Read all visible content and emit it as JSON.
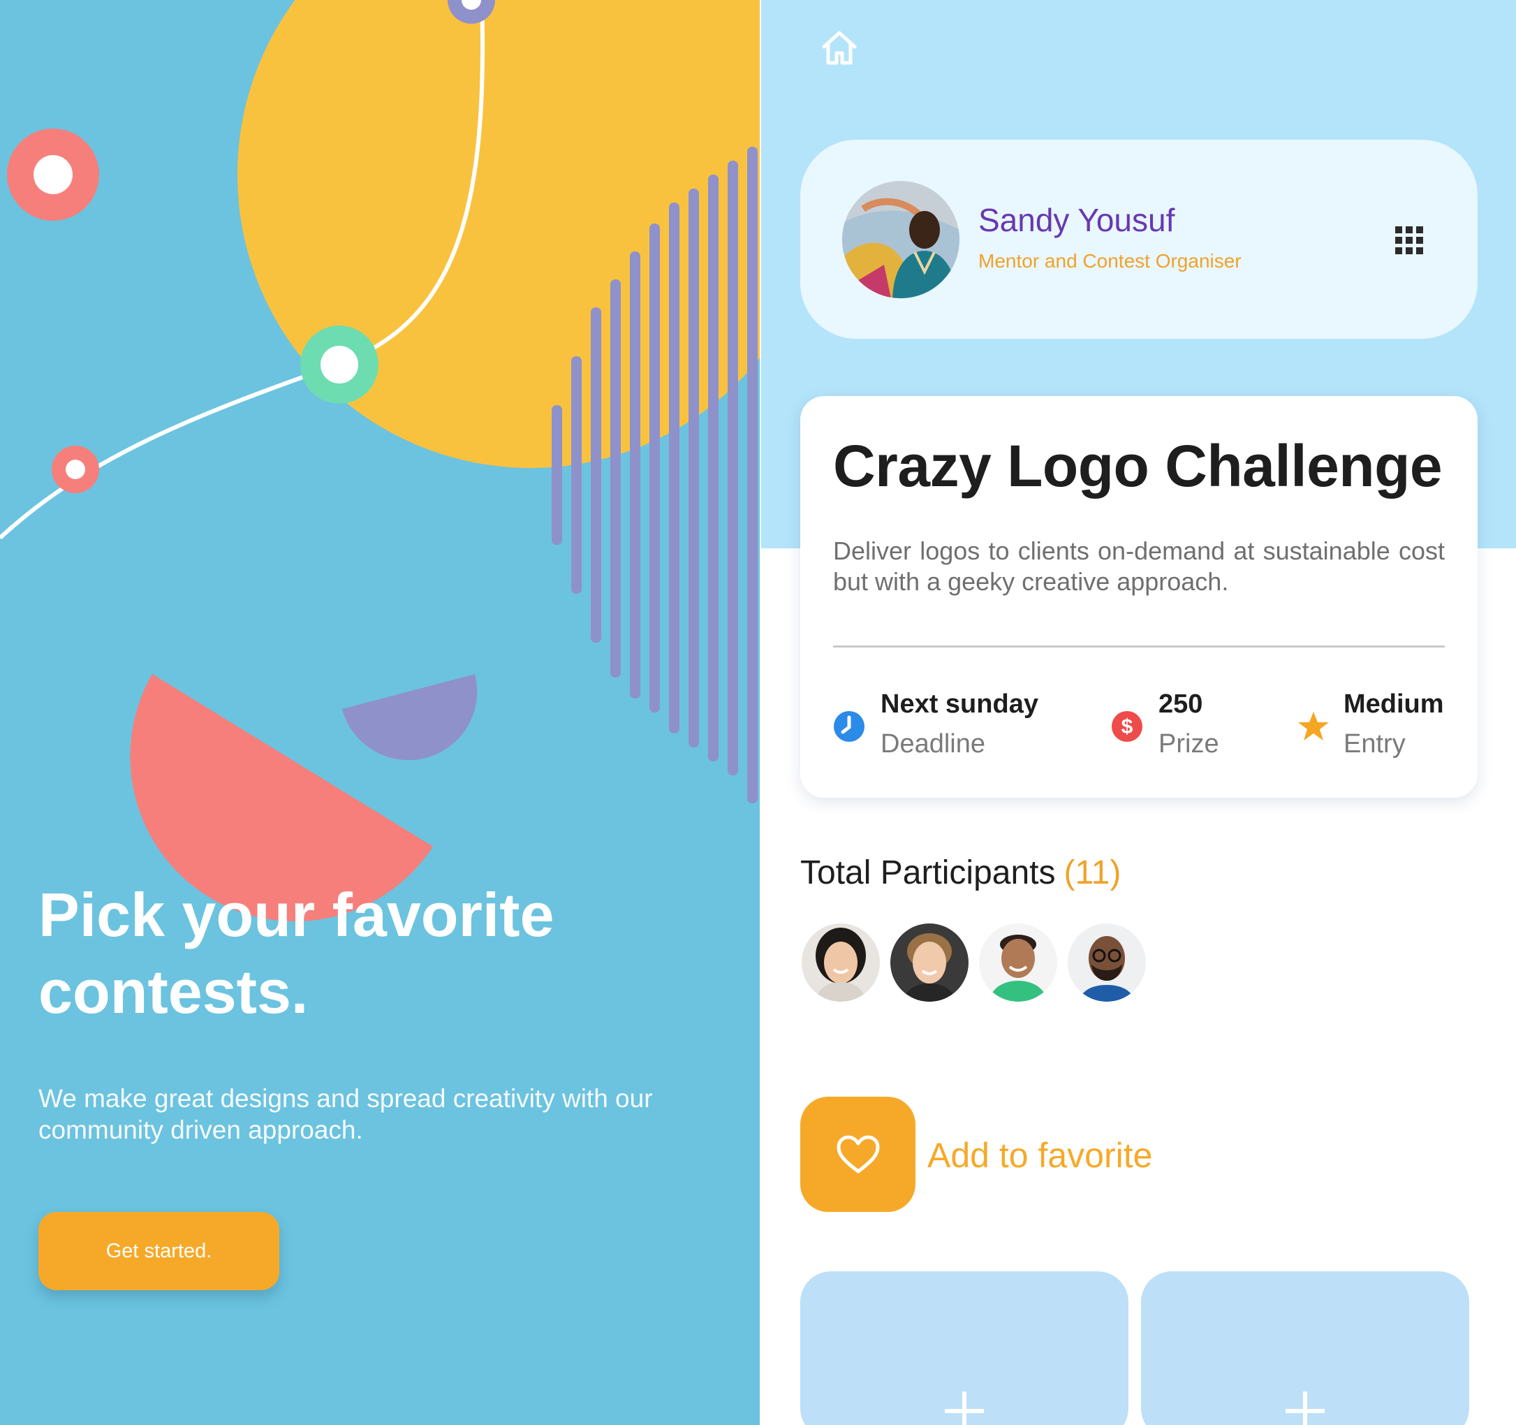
{
  "onboarding": {
    "title_line1": "Pick your favorite",
    "title_line2": "contests.",
    "subtitle": "We make great designs and spread creativity with our community driven approach.",
    "cta_label": "Get started.",
    "colors": {
      "background": "#6bc3df",
      "cta": "#f6a928",
      "sun": "#f9c23e",
      "coral": "#f67f7b",
      "purple": "#8f91cb"
    }
  },
  "contest_screen": {
    "nav": {
      "home_icon": "home-icon"
    },
    "profile": {
      "name": "Sandy Yousuf",
      "role": "Mentor and Contest Organiser",
      "menu_icon": "grid-icon"
    },
    "contest": {
      "title": "Crazy Logo Challenge",
      "description": "Deliver logos to clients on-demand at sustainable cost but with a geeky creative approach.",
      "stats": [
        {
          "icon": "clock-icon",
          "value": "Next sunday",
          "label": "Deadline",
          "color": "#2c8ae8"
        },
        {
          "icon": "dollar-icon",
          "value": "250",
          "label": "Prize",
          "color": "#ee4b4b"
        },
        {
          "icon": "star-icon",
          "value": "Medium",
          "label": "Entry",
          "color": "#f4a623"
        }
      ]
    },
    "participants": {
      "title": "Total Participants",
      "count": "(11)",
      "avatars": [
        "avatar-1",
        "avatar-2",
        "avatar-3",
        "avatar-4"
      ]
    },
    "favorite": {
      "label": "Add to favorite",
      "icon": "heart-icon"
    },
    "add_tiles": [
      "plus-icon",
      "plus-icon"
    ],
    "colors": {
      "header_bg": "#b3e4fa",
      "name": "#6838b1",
      "accent": "#f0a22a",
      "tile": "#bde0f8"
    }
  }
}
